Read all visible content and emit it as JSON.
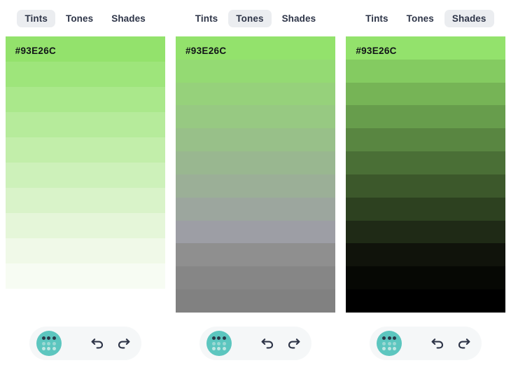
{
  "base_color": "#93E26C",
  "columns": [
    {
      "id": "tints",
      "tabs": [
        {
          "label": "Tints",
          "name": "tab-tints",
          "active": true
        },
        {
          "label": "Tones",
          "name": "tab-tones",
          "active": false
        },
        {
          "label": "Shades",
          "name": "tab-shades",
          "active": false
        }
      ],
      "hex_label": "#93E26C",
      "panel_height": "short",
      "swatches": [
        "#93E26C",
        "#9EE57B",
        "#AAE88B",
        "#B6EB9B",
        "#C2EEAA",
        "#CDF1BA",
        "#D9F3C9",
        "#E5F6D9",
        "#F0F9E8",
        "#F7FCF3"
      ]
    },
    {
      "id": "tones",
      "tabs": [
        {
          "label": "Tints",
          "name": "tab-tints",
          "active": false
        },
        {
          "label": "Tones",
          "name": "tab-tones",
          "active": true
        },
        {
          "label": "Shades",
          "name": "tab-shades",
          "active": false
        }
      ],
      "hex_label": "#93E26C",
      "panel_height": "tall",
      "swatches": [
        "#93E26C",
        "#94DA73",
        "#96D17B",
        "#97C982",
        "#98C089",
        "#99B790",
        "#9BAF97",
        "#9CA69E",
        "#9D9EA5",
        "#8F8F8F",
        "#868686",
        "#818181"
      ]
    },
    {
      "id": "shades",
      "tabs": [
        {
          "label": "Tints",
          "name": "tab-tints",
          "active": false
        },
        {
          "label": "Tones",
          "name": "tab-tones",
          "active": false
        },
        {
          "label": "Shades",
          "name": "tab-shades",
          "active": true
        }
      ],
      "hex_label": "#93E26C",
      "panel_height": "tall",
      "swatches": [
        "#93E26C",
        "#84CB61",
        "#76B456",
        "#679D4C",
        "#598641",
        "#4A6F36",
        "#3C582B",
        "#2D4120",
        "#1F2A16",
        "#10130B",
        "#060804",
        "#000000"
      ]
    }
  ],
  "toolbar": {
    "palette_button_label": "palette",
    "palette_button_color": "#5CC6BF",
    "undo_label": "undo",
    "redo_label": "redo"
  }
}
